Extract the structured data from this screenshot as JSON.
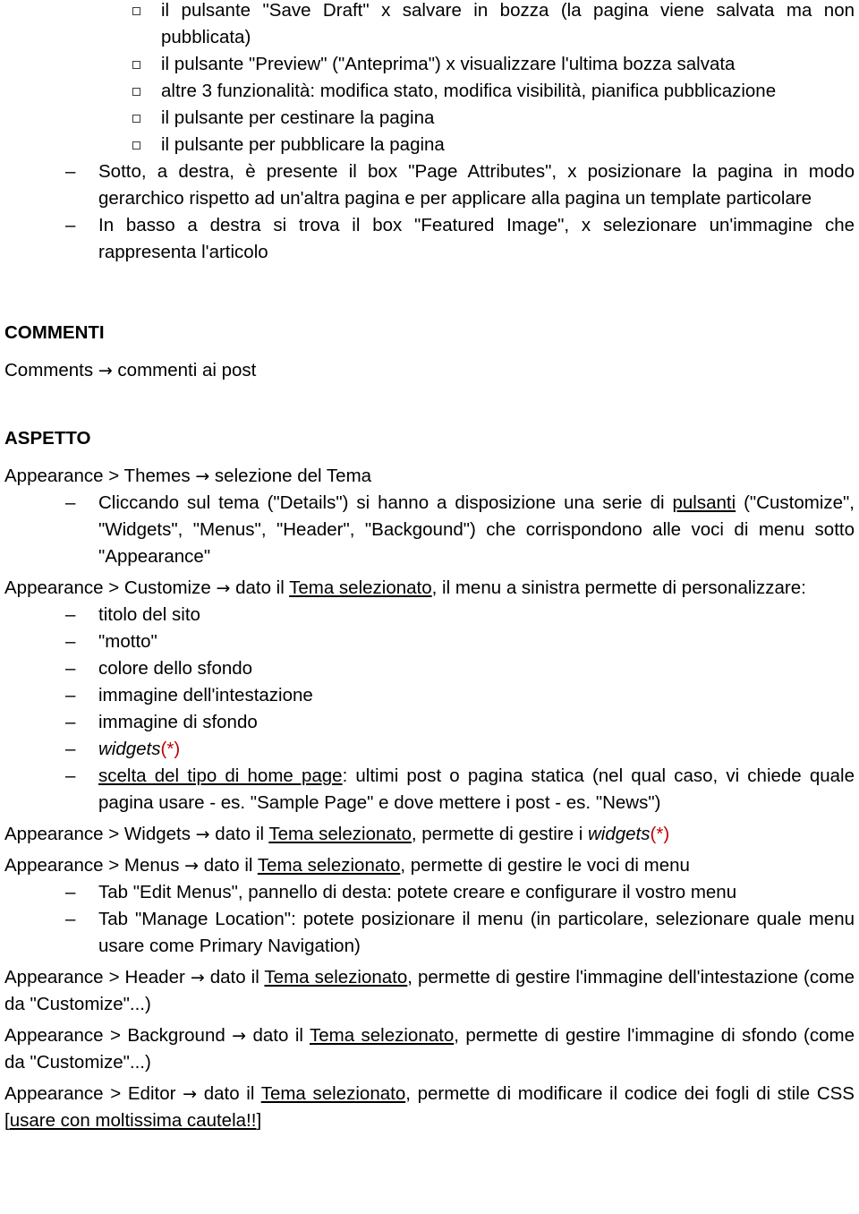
{
  "document": {
    "bullet_level1_marker": "–",
    "bullet_level2_marker": "square-outline",
    "accent_red": "#C00000",
    "text_color": "#000000",
    "background": "#ffffff"
  },
  "section_pagine": {
    "bullets_level2": [
      "il pulsante \"Save Draft\" x salvare in bozza (la pagina viene salvata ma non pubblicata)",
      "il pulsante \"Preview\" (\"Anteprima\") x visualizzare l'ultima bozza salvata",
      "altre 3 funzionalità: modifica stato, modifica visibilità, pianifica pubblicazione",
      "il pulsante per cestinare la pagina",
      "il pulsante per pubblicare la pagina"
    ],
    "bullets_level1": [
      "Sotto, a destra, è presente il box \"Page Attributes\", x posizionare la pagina in modo gerarchico rispetto ad un'altra pagina   e per applicare alla pagina un template particolare",
      "In basso a destra si trova il box \"Featured Image\", x selezionare un'immagine che rappresenta l'articolo"
    ]
  },
  "section_commenti": {
    "heading": "COMMENTI",
    "line": {
      "before": "Comments ",
      "arrow": "→",
      "after": " commenti ai post"
    }
  },
  "section_aspetto": {
    "heading": "ASPETTO",
    "themes": {
      "before": "Appearance > Themes ",
      "arrow": "→",
      "after": " selezione del Tema"
    },
    "themes_bullet": {
      "part1": "Cliccando sul tema (\"Details\") si hanno a disposizione una serie di ",
      "underlined1": "pulsanti",
      "part2": " (\"Customize\", \"Widgets\", \"Menus\", \"Header\", \"Backgound\") che corrispondono alle voci di menu sotto \"Appearance\""
    },
    "customize": {
      "before": "Appearance > Customize ",
      "arrow": "→",
      "mid": " dato il ",
      "underlined": "Tema selezionato",
      "after": ", il menu a sinistra permette di personalizzare:"
    },
    "customize_items": [
      "titolo del sito",
      "\"motto\"",
      "colore dello sfondo",
      "immagine dell'intestazione",
      "immagine di sfondo"
    ],
    "customize_widgets_item": {
      "italic": "widgets",
      "red": "(*)"
    },
    "customize_homepage_item": {
      "underlined": "scelta del tipo di home page",
      "rest": ": ultimi post o pagina statica (nel qual caso, vi chiede quale pagina usare - es. \"Sample Page\" e dove mettere i post - es. \"News\")"
    },
    "widgets": {
      "before": "Appearance > Widgets ",
      "arrow": "→",
      "mid": " dato il ",
      "underlined": "Tema selezionato",
      "after": ", permette di gestire i ",
      "italic": "widgets",
      "red": "(*)"
    },
    "menus": {
      "before": "Appearance > Menus ",
      "arrow": "→",
      "mid": " dato il ",
      "underlined": "Tema selezionato",
      "after": ", permette di gestire le voci di menu"
    },
    "menus_items": [
      "Tab \"Edit Menus\", pannello di desta: potete creare e configurare il vostro menu",
      "Tab \"Manage Location\": potete posizionare il menu (in particolare, selezionare quale menu usare come Primary Navigation)"
    ],
    "header": {
      "before": "Appearance > Header ",
      "arrow": "→",
      "mid": " dato il ",
      "underlined": "Tema selezionato",
      "after": ", permette di gestire l'immagine dell'intestazione (come da \"Customize\"...)"
    },
    "background": {
      "before": "Appearance > Background ",
      "arrow": "→",
      "mid": " dato il ",
      "underlined": "Tema selezionato",
      "after": ", permette di gestire l'immagine di sfondo (come da \"Customize\"...)"
    },
    "editor": {
      "before": "Appearance > Editor ",
      "arrow": "→",
      "mid": " dato il ",
      "underlined": "Tema selezionato",
      "after": ", permette di modificare il codice dei fogli di stile CSS [",
      "underlined2": "usare con moltissima cautela!!",
      "tail": "]"
    }
  }
}
